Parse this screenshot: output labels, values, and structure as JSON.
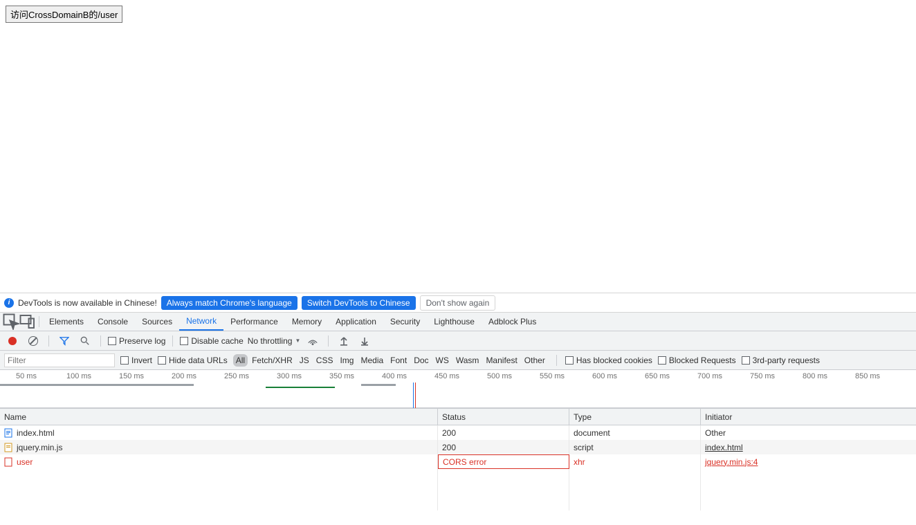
{
  "page": {
    "button_label": "访问CrossDomainB的/user"
  },
  "infobar": {
    "text": "DevTools is now available in Chinese!",
    "btn_match": "Always match Chrome's language",
    "btn_switch": "Switch DevTools to Chinese",
    "btn_dismiss": "Don't show again"
  },
  "tabs": {
    "items": [
      "Elements",
      "Console",
      "Sources",
      "Network",
      "Performance",
      "Memory",
      "Application",
      "Security",
      "Lighthouse",
      "Adblock Plus"
    ],
    "active": "Network"
  },
  "toolbar": {
    "preserve_log": "Preserve log",
    "disable_cache": "Disable cache",
    "throttling": "No throttling"
  },
  "filterbar": {
    "filter_placeholder": "Filter",
    "invert": "Invert",
    "hide_data": "Hide data URLs",
    "types": [
      "All",
      "Fetch/XHR",
      "JS",
      "CSS",
      "Img",
      "Media",
      "Font",
      "Doc",
      "WS",
      "Wasm",
      "Manifest",
      "Other"
    ],
    "type_active": "All",
    "has_blocked": "Has blocked cookies",
    "blocked_req": "Blocked Requests",
    "third_party": "3rd-party requests"
  },
  "timeline": {
    "labels": [
      "50 ms",
      "100 ms",
      "150 ms",
      "200 ms",
      "250 ms",
      "300 ms",
      "350 ms",
      "400 ms",
      "450 ms",
      "500 ms",
      "550 ms",
      "600 ms",
      "650 ms",
      "700 ms",
      "750 ms",
      "800 ms",
      "850 ms"
    ]
  },
  "table": {
    "headers": {
      "name": "Name",
      "status": "Status",
      "type": "Type",
      "initiator": "Initiator"
    },
    "rows": [
      {
        "icon": "doc",
        "name": "index.html",
        "status": "200",
        "type": "document",
        "initiator": "Other",
        "error": false,
        "init_link": false
      },
      {
        "icon": "script",
        "name": "jquery.min.js",
        "status": "200",
        "type": "script",
        "initiator": "index.html",
        "error": false,
        "init_link": true
      },
      {
        "icon": "xhr",
        "name": "user",
        "status": "CORS error",
        "type": "xhr",
        "initiator": "jquery.min.js:4",
        "error": true,
        "init_link": true
      }
    ]
  }
}
